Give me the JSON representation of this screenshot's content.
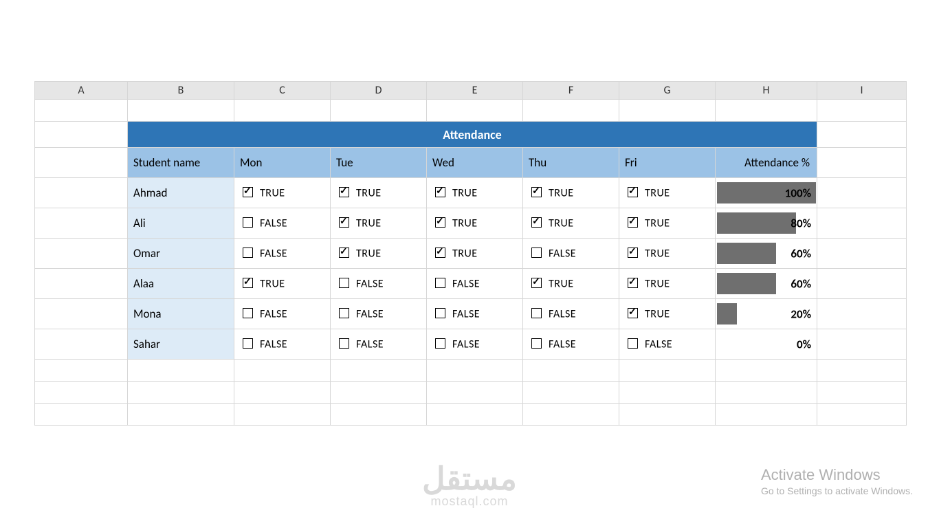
{
  "columns": [
    "A",
    "B",
    "C",
    "D",
    "E",
    "F",
    "G",
    "H",
    "I"
  ],
  "title": "Attendance",
  "headers": {
    "student": "Student name",
    "days": [
      "Mon",
      "Tue",
      "Wed",
      "Thu",
      "Fri"
    ],
    "pct": "Attendance %"
  },
  "labels": {
    "true": "TRUE",
    "false": "FALSE"
  },
  "rows": [
    {
      "name": "Ahmad",
      "days": [
        true,
        true,
        true,
        true,
        true
      ],
      "pct": "100%",
      "bar": 100
    },
    {
      "name": "Ali",
      "days": [
        false,
        true,
        true,
        true,
        true
      ],
      "pct": "80%",
      "bar": 80
    },
    {
      "name": "Omar",
      "days": [
        false,
        true,
        true,
        false,
        true
      ],
      "pct": "60%",
      "bar": 60
    },
    {
      "name": "Alaa",
      "days": [
        true,
        false,
        false,
        true,
        true
      ],
      "pct": "60%",
      "bar": 60
    },
    {
      "name": "Mona",
      "days": [
        false,
        false,
        false,
        false,
        true
      ],
      "pct": "20%",
      "bar": 20
    },
    {
      "name": "Sahar",
      "days": [
        false,
        false,
        false,
        false,
        false
      ],
      "pct": "0%",
      "bar": 0
    }
  ],
  "watermarks": {
    "windows_line1": "Activate Windows",
    "windows_line2": "Go to Settings to activate Windows.",
    "mostaql_ar": "مستقل",
    "mostaql_en": "mostaql.com"
  }
}
